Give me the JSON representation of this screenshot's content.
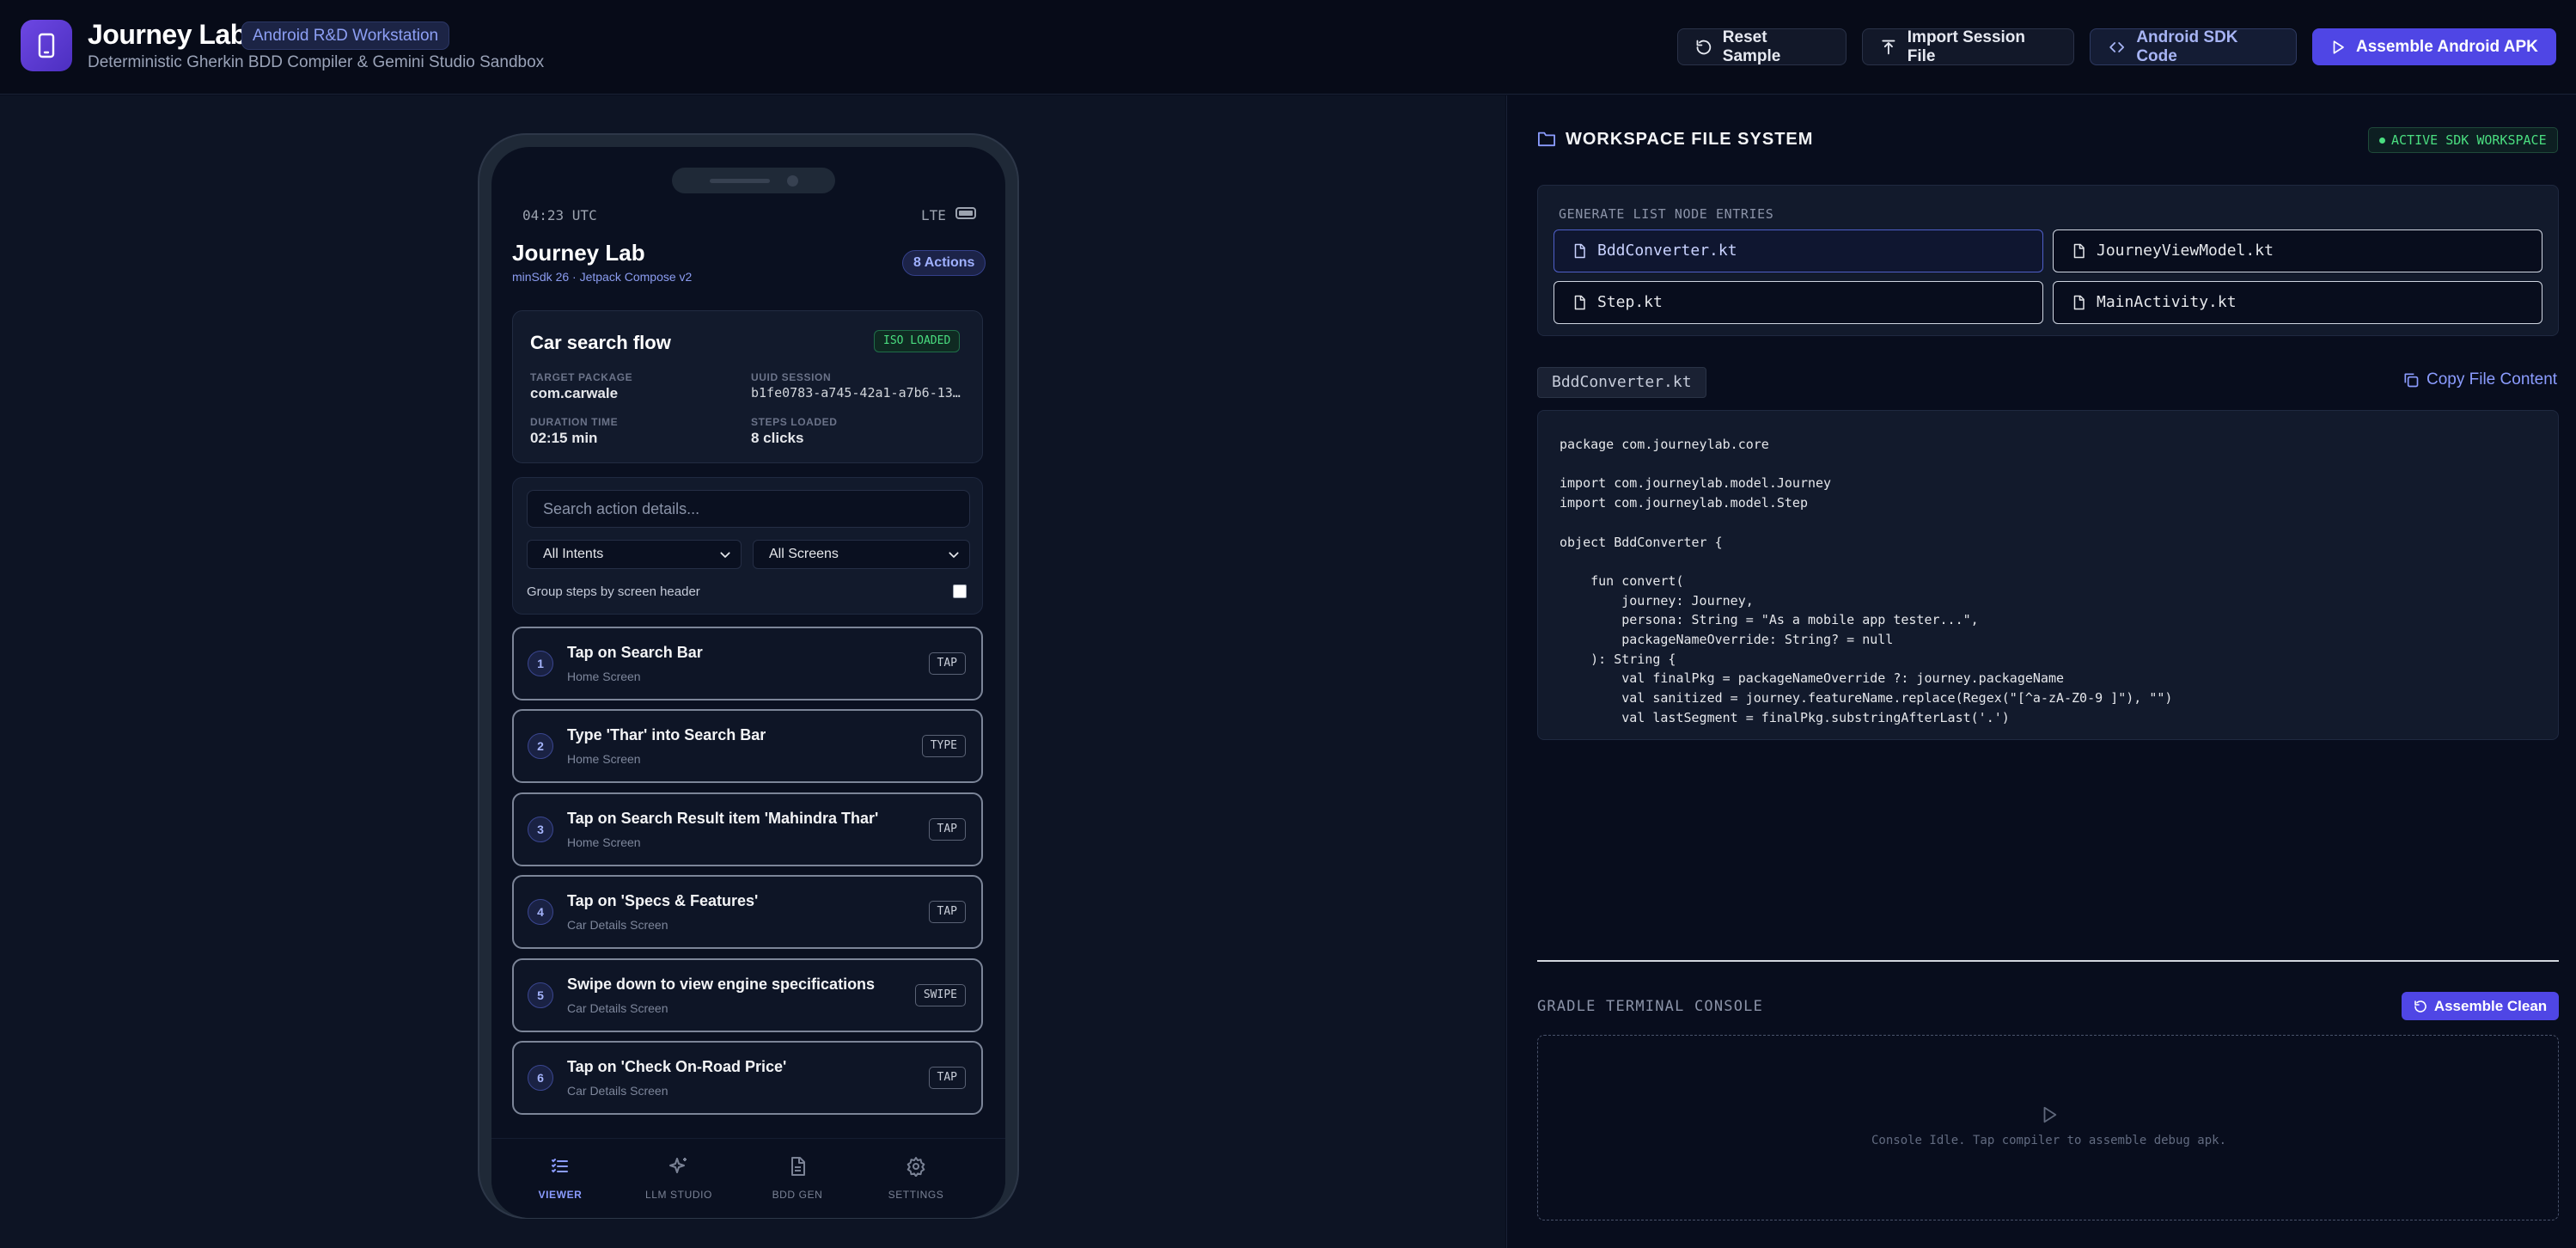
{
  "header": {
    "title": "Journey Lab",
    "badge": "Android R&D Workstation",
    "subtitle": "Deterministic Gherkin BDD Compiler & Gemini Studio Sandbox",
    "buttons": {
      "reset": "Reset Sample",
      "import": "Import Session File",
      "sdk_code": "Android SDK Code",
      "assemble": "Assemble Android APK"
    }
  },
  "phone": {
    "status_time": "04:23 UTC",
    "status_network": "LTE",
    "title": "Journey Lab",
    "subtitle": "minSdk 26 · Jetpack Compose v2",
    "actions_badge": "8 Actions",
    "flow": {
      "title": "Car search flow",
      "status_badge": "ISO LOADED",
      "target_package_label": "TARGET PACKAGE",
      "target_package": "com.carwale",
      "uuid_label": "UUID SESSION",
      "uuid": "b1fe0783-a745-42a1-a7b6-13…",
      "duration_label": "DURATION TIME",
      "duration": "02:15 min",
      "steps_label": "STEPS LOADED",
      "steps": "8 clicks"
    },
    "filters": {
      "search_placeholder": "Search action details...",
      "intent_select": "All Intents",
      "screen_select": "All Screens",
      "group_label": "Group steps by screen header",
      "group_checked": false
    },
    "steps": [
      {
        "num": "1",
        "title": "Tap on Search Bar",
        "screen": "Home Screen",
        "type": "TAP"
      },
      {
        "num": "2",
        "title": "Type 'Thar' into Search Bar",
        "screen": "Home Screen",
        "type": "TYPE"
      },
      {
        "num": "3",
        "title": "Tap on Search Result item 'Mahindra Thar'",
        "screen": "Home Screen",
        "type": "TAP"
      },
      {
        "num": "4",
        "title": "Tap on 'Specs & Features'",
        "screen": "Car Details Screen",
        "type": "TAP"
      },
      {
        "num": "5",
        "title": "Swipe down to view engine specifications",
        "screen": "Car Details Screen",
        "type": "SWIPE"
      },
      {
        "num": "6",
        "title": "Tap on 'Check On-Road Price'",
        "screen": "Car Details Screen",
        "type": "TAP"
      }
    ],
    "nav": [
      {
        "label": "VIEWER",
        "icon": "list-icon",
        "active": true
      },
      {
        "label": "LLM STUDIO",
        "icon": "sparkles-icon",
        "active": false
      },
      {
        "label": "BDD GEN",
        "icon": "document-icon",
        "active": false
      },
      {
        "label": "SETTINGS",
        "icon": "gear-icon",
        "active": false
      }
    ]
  },
  "workspace": {
    "title": "WORKSPACE FILE SYSTEM",
    "badge": "ACTIVE SDK WORKSPACE",
    "generate_title": "GENERATE LIST NODE ENTRIES",
    "files": [
      "BddConverter.kt",
      "JourneyViewModel.kt",
      "Step.kt",
      "MainActivity.kt"
    ],
    "selected_file": "BddConverter.kt",
    "copy_label": "Copy File Content",
    "code": "package com.journeylab.core\n\nimport com.journeylab.model.Journey\nimport com.journeylab.model.Step\n\nobject BddConverter {\n\n    fun convert(\n        journey: Journey,\n        persona: String = \"As a mobile app tester...\",\n        packageNameOverride: String? = null\n    ): String {\n        val finalPkg = packageNameOverride ?: journey.packageName\n        val sanitized = journey.featureName.replace(Regex(\"[^a-zA-Z0-9 ]\"), \"\")\n        val lastSegment = finalPkg.substringAfterLast('.')"
  },
  "console": {
    "title": "GRADLE TERMINAL CONSOLE",
    "button": "Assemble Clean",
    "idle_text": "Console Idle. Tap compiler to assemble debug apk."
  },
  "colors": {
    "accent": "#4f46e5",
    "accent_text": "#8b9cff",
    "success": "#4ade80",
    "background": "#080d1d",
    "panel": "#121a2c"
  }
}
